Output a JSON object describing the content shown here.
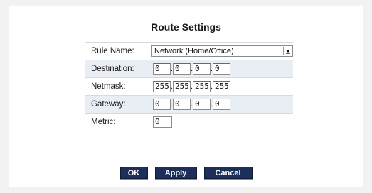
{
  "title": "Route Settings",
  "rule_name": {
    "label": "Rule Name:",
    "value": "Network (Home/Office)"
  },
  "destination": {
    "label": "Destination:",
    "octets": [
      "0",
      "0",
      "0",
      "0"
    ]
  },
  "netmask": {
    "label": "Netmask:",
    "octets": [
      "255",
      "255",
      "255",
      "255"
    ]
  },
  "gateway": {
    "label": "Gateway:",
    "octets": [
      "0",
      "0",
      "0",
      "0"
    ]
  },
  "metric": {
    "label": "Metric:",
    "value": "0"
  },
  "buttons": {
    "ok": "OK",
    "apply": "Apply",
    "cancel": "Cancel"
  },
  "icons": {
    "dropdown": "chevron-down-icon"
  },
  "colors": {
    "button_bg": "#1b2f5a",
    "row_shade": "#e9edf4"
  }
}
